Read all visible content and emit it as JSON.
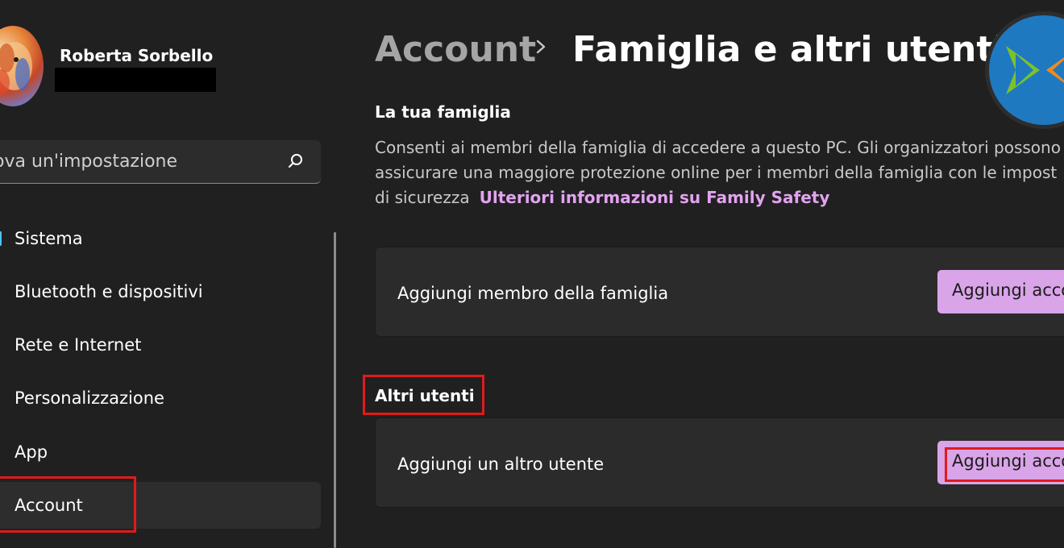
{
  "profile": {
    "name": "Roberta Sorbello"
  },
  "search": {
    "visible_text": "ova un'impostazione",
    "icon": "search-icon"
  },
  "sidebar": {
    "items": [
      {
        "label": "Sistema"
      },
      {
        "label": "Bluetooth e dispositivi"
      },
      {
        "label": "Rete e Internet"
      },
      {
        "label": "Personalizzazione"
      },
      {
        "label": "App"
      },
      {
        "label": "Account"
      }
    ],
    "active": "Account"
  },
  "header": {
    "breadcrumb_parent": "Account",
    "breadcrumb_separator_icon": "chevron-right-icon",
    "title": "Famiglia e altri utenti"
  },
  "family": {
    "title": "La tua famiglia",
    "desc_line1": "Consenti ai membri della famiglia di accedere a questo PC. Gli organizzatori possono",
    "desc_line2": "assicurare una maggiore protezione online per i membri della famiglia con le impost",
    "desc_line3": "di sicurezza",
    "link": "Ulteriori informazioni su Family Safety",
    "card_label": "Aggiungi membro della famiglia",
    "card_button": "Aggiungi account"
  },
  "others": {
    "title": "Altri utenti",
    "card_label": "Aggiungi un altro utente",
    "card_button": "Aggiungi account"
  },
  "colors": {
    "background": "#202020",
    "accent_button": "#d9a4e8",
    "link": "#e2a3f0",
    "highlight_box": "#e01b1b",
    "nav_indicator": "#4cc2ff"
  }
}
